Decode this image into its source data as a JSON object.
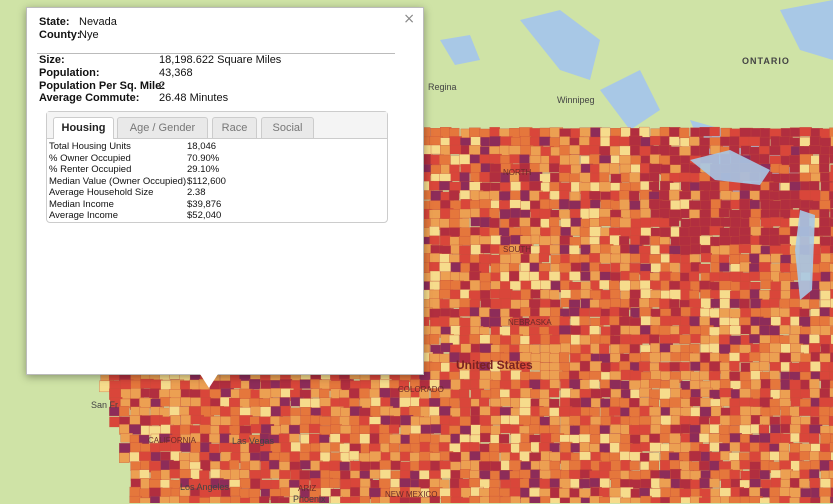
{
  "map": {
    "labels": {
      "ontario": "ONTARIO",
      "regina": "Regina",
      "winnipeg": "Winnipeg",
      "north_dakota": "NORTH",
      "south_dakota": "SOUTH",
      "nebraska": "NEBRASKA",
      "united_states": "United States",
      "colorado": "COLORADO",
      "san_francisco": "San Fr",
      "california": "CALIFORNIA",
      "las_vegas": "Las Vegas",
      "los_angeles": "Los Angeles",
      "arizona": "ARIZ",
      "phoenix": "Phoenix",
      "new_mexico": "NEW MEXICO"
    },
    "colors": {
      "light": "#f6dc8c",
      "mid": "#eca052",
      "orange": "#e5773c",
      "red": "#d9463a",
      "dark": "#b12e3f",
      "purple": "#8d2c59",
      "water": "#a8c8e6",
      "land": "#cfe3a6"
    }
  },
  "popup": {
    "state_label": "State:",
    "state_value": "Nevada",
    "county_label": "County:",
    "county_value": "Nye",
    "size_label": "Size:",
    "size_value": "18,198.622 Square Miles",
    "population_label": "Population:",
    "population_value": "43,368",
    "density_label": "Population Per Sq. Mile:",
    "density_value": "2",
    "commute_label": "Average Commute:",
    "commute_value": "26.48 Minutes",
    "close_icon": "×",
    "tabs": [
      "Housing",
      "Age / Gender",
      "Race",
      "Social"
    ],
    "housing_rows": [
      {
        "label": "Total Housing Units",
        "value": "18,046"
      },
      {
        "label": "% Owner Occupied",
        "value": "70.90%"
      },
      {
        "label": "% Renter Occupied",
        "value": "29.10%"
      },
      {
        "label": "Median Value (Owner Occupied)",
        "value": "$112,600"
      },
      {
        "label": "Average Household Size",
        "value": "2.38"
      },
      {
        "label": "Median Income",
        "value": "$39,876"
      },
      {
        "label": "Average Income",
        "value": "$52,040"
      }
    ]
  }
}
